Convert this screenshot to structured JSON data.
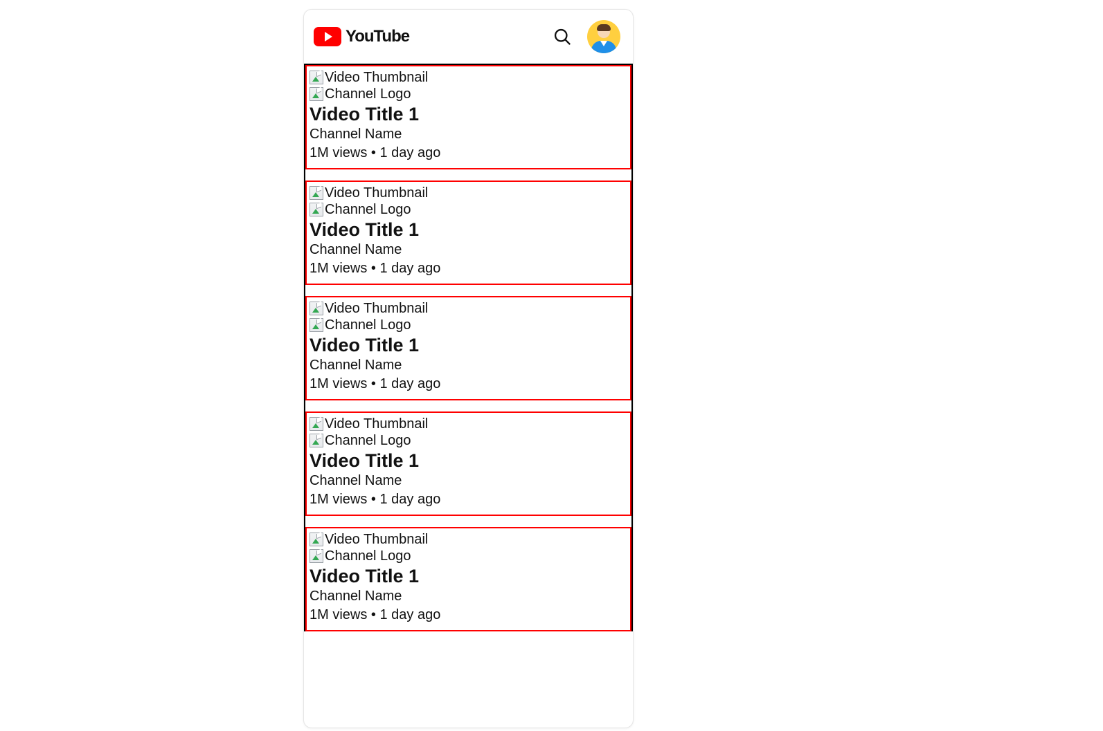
{
  "header": {
    "brand": "YouTube",
    "search_label": "Search"
  },
  "video_card_labels": {
    "thumbnail_alt": "Video Thumbnail",
    "channel_logo_alt": "Channel Logo"
  },
  "videos": [
    {
      "title": "Video Title 1",
      "channel": "Channel Name",
      "meta": "1M views • 1 day ago"
    },
    {
      "title": "Video Title 1",
      "channel": "Channel Name",
      "meta": "1M views • 1 day ago"
    },
    {
      "title": "Video Title 1",
      "channel": "Channel Name",
      "meta": "1M views • 1 day ago"
    },
    {
      "title": "Video Title 1",
      "channel": "Channel Name",
      "meta": "1M views • 1 day ago"
    },
    {
      "title": "Video Title 1",
      "channel": "Channel Name",
      "meta": "1M views • 1 day ago"
    }
  ]
}
